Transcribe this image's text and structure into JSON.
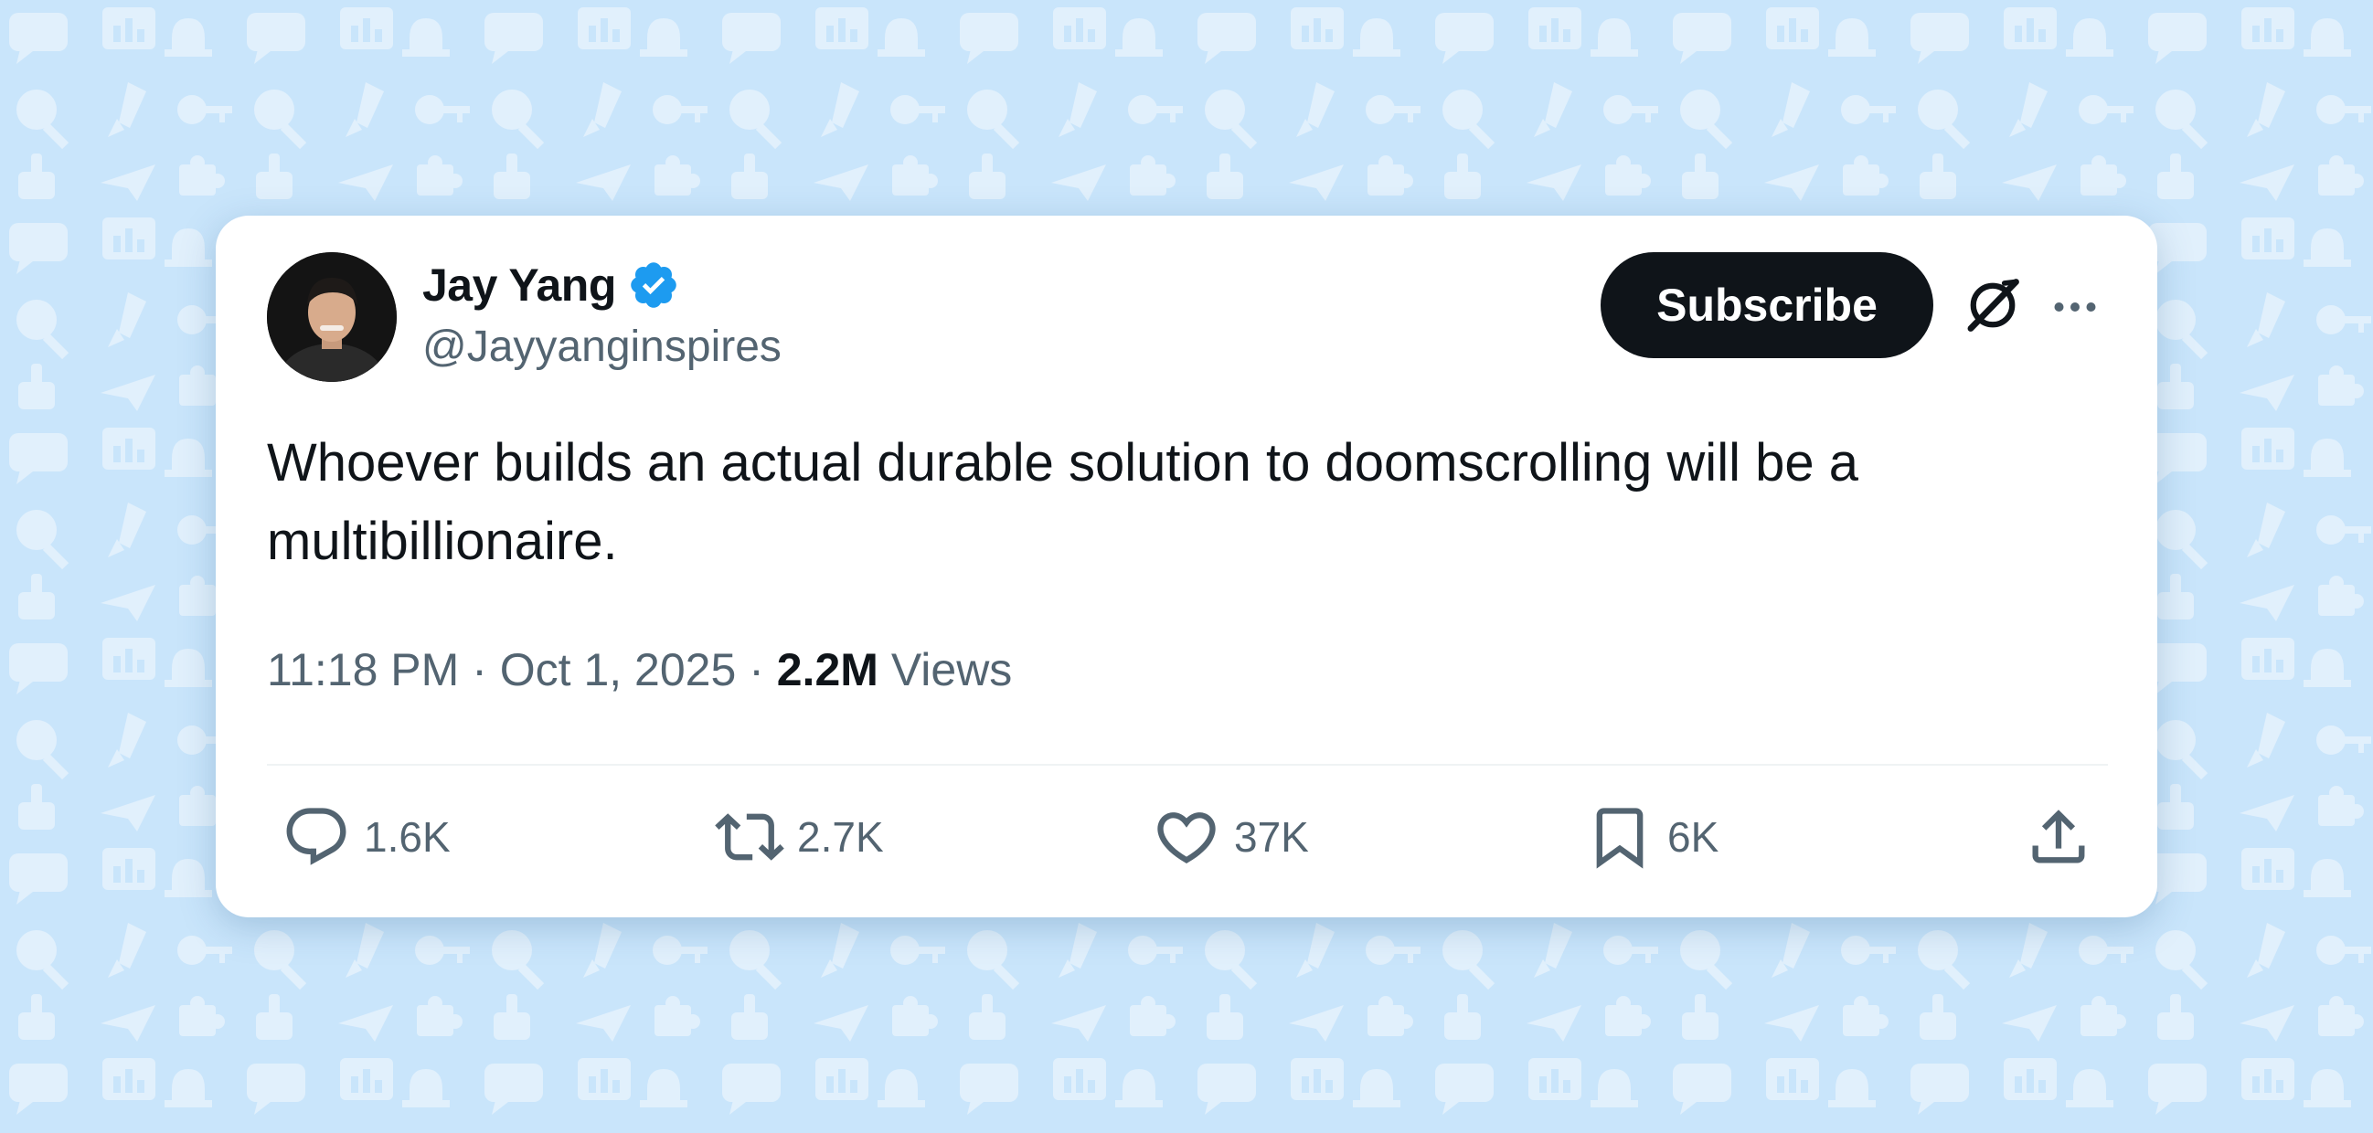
{
  "tweet": {
    "display_name": "Jay Yang",
    "handle": "@Jayyanginspires",
    "subscribe_label": "Subscribe",
    "text": "Whoever builds an actual durable solution to doomscrolling will be a multibillionaire.",
    "time": "11:18 PM",
    "separator": "·",
    "date": "Oct 1, 2025",
    "views_count": "2.2M",
    "views_label": "Views"
  },
  "actions": {
    "replies": "1.6K",
    "reposts": "2.7K",
    "likes": "37K",
    "bookmarks": "6K"
  },
  "colors": {
    "background": "#c9e5fb",
    "pattern": "#e1f0fc",
    "verified": "#1d9bf0",
    "text_primary": "#0f1419",
    "text_secondary": "#536471",
    "button_bg": "#0f1419"
  },
  "icons": {
    "verified": "verified-badge-icon",
    "grok": "grok-icon",
    "more": "more-icon",
    "reply": "reply-icon",
    "repost": "repost-icon",
    "like": "heart-icon",
    "bookmark": "bookmark-icon",
    "share": "share-icon"
  }
}
